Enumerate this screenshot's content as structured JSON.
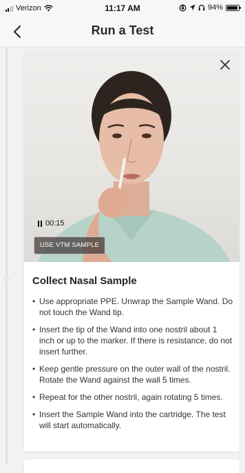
{
  "status_bar": {
    "carrier": "Verizon",
    "time": "11:17 AM",
    "battery": "94%",
    "battery_level": 0.94
  },
  "nav": {
    "title": "Run a Test",
    "back_icon": "chevron-left-icon"
  },
  "video": {
    "elapsed": "00:15",
    "vtm_button_label": "USE VTM SAMPLE",
    "close_icon": "close-icon",
    "pause_icon": "pause-icon"
  },
  "step": {
    "title": "Collect Nasal Sample",
    "instructions": [
      "Use appropriate PPE. Unwrap the Sample Wand. Do not touch the Wand tip.",
      "Insert the tip of the Wand into one nostril about 1 inch or up to the marker. If there is resistance, do not insert further.",
      "Keep gentle pressure on the outer wall of the nostril. Rotate the Wand against the wall 5 times.",
      "Repeat for the other nostril, again rotating 5 times.",
      "Insert the Sample Wand into the cartridge. The test will start automatically."
    ]
  }
}
